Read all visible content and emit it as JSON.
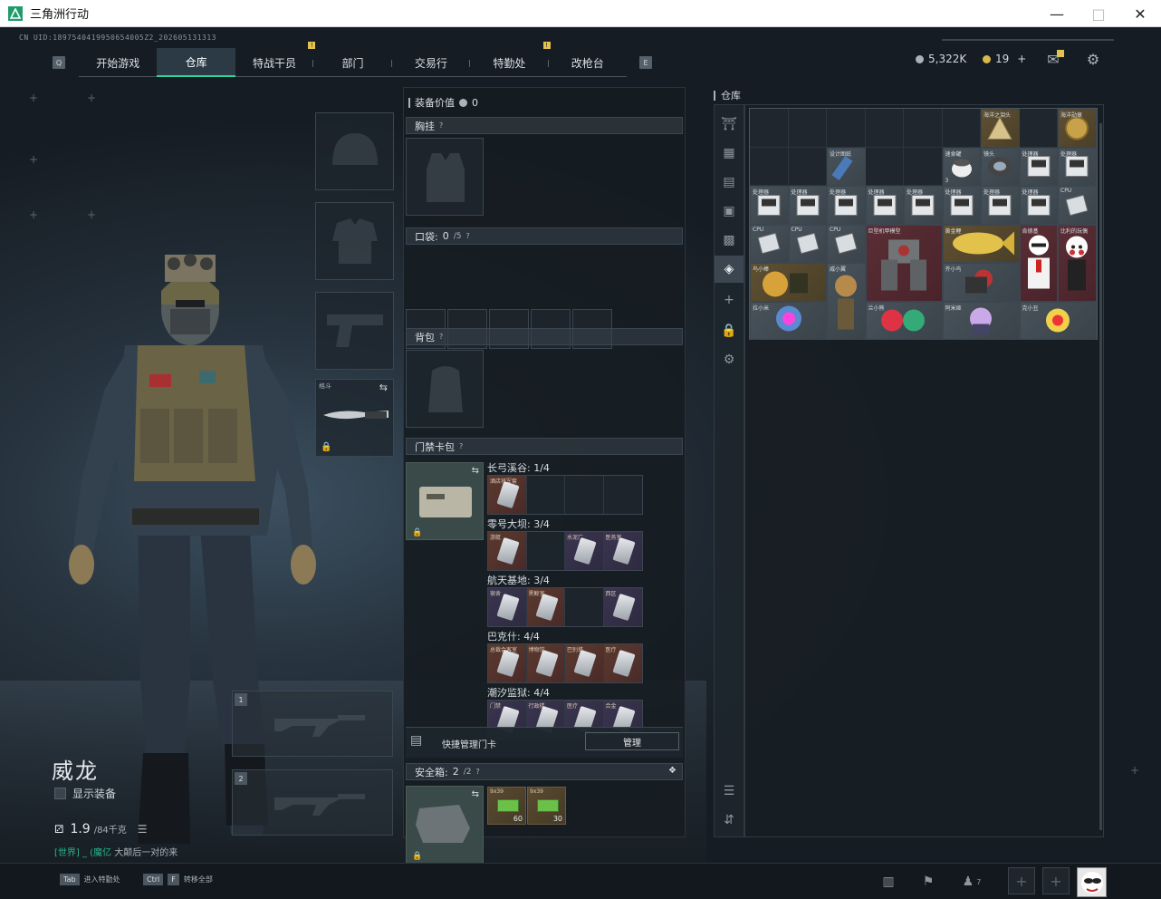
{
  "window": {
    "title": "三角洲行动"
  },
  "uid": "CN UID:1897540419950654005Z2_202605131313",
  "nav": {
    "left_key": "Q",
    "right_key": "E",
    "tabs": [
      {
        "label": "开始游戏",
        "active": false,
        "badge": false
      },
      {
        "label": "仓库",
        "active": true,
        "badge": false
      },
      {
        "label": "特战干员",
        "active": false,
        "badge": true
      },
      {
        "label": "部门",
        "active": false,
        "badge": false
      },
      {
        "label": "交易行",
        "active": false,
        "badge": false
      },
      {
        "label": "特勤处",
        "active": false,
        "badge": true
      },
      {
        "label": "改枪台",
        "active": false,
        "badge": false
      }
    ]
  },
  "currency": {
    "hafcoin": "5,322K",
    "coupons": "19",
    "add": "+"
  },
  "operator": {
    "name": "威龙",
    "show_equipment": "显示装备",
    "weight": "1.9",
    "weight_max": "/84千克",
    "chat_channel": "[世界] _ (魔亿",
    "chat_message": "大颠后一对的来"
  },
  "melee": {
    "label": "格斗"
  },
  "weapon_slots": [
    "1",
    "2"
  ],
  "equipment": {
    "value_label": "装备价值",
    "value": "0",
    "chest_rig": "胸挂",
    "pockets": "口袋:",
    "pockets_count": "0",
    "pockets_max": "/5",
    "backpack": "背包",
    "keycard_case": "门禁卡包",
    "maps": [
      {
        "name": "长弓溪谷: 1/4",
        "cards": [
          {
            "label": "酒店将军套",
            "q": "gold"
          },
          {
            "label": "",
            "q": ""
          },
          {
            "label": "",
            "q": ""
          },
          {
            "label": "",
            "q": ""
          }
        ]
      },
      {
        "name": "零号大坝: 3/4",
        "cards": [
          {
            "label": "游艇",
            "q": "gold"
          },
          {
            "label": "",
            "q": ""
          },
          {
            "label": "水泥厂",
            "q": "purple"
          },
          {
            "label": "医务室",
            "q": "purple"
          }
        ]
      },
      {
        "name": "航天基地: 3/4",
        "cards": [
          {
            "label": "宿舍",
            "q": "purple"
          },
          {
            "label": "黑鲸室",
            "q": "gold"
          },
          {
            "label": "",
            "q": ""
          },
          {
            "label": "西区",
            "q": "purple"
          }
        ]
      },
      {
        "name": "巴克什: 4/4",
        "cards": [
          {
            "label": "总裁会客室",
            "q": "gold"
          },
          {
            "label": "博物馆",
            "q": "gold"
          },
          {
            "label": "巴别塔",
            "q": "gold"
          },
          {
            "label": "医疗",
            "q": "gold"
          }
        ]
      },
      {
        "name": "潮汐监狱: 4/4",
        "cards": [
          {
            "label": "门禁",
            "q": "purple"
          },
          {
            "label": "行政楼",
            "q": "purple"
          },
          {
            "label": "医疗",
            "q": "purple"
          },
          {
            "label": "合金",
            "q": "purple"
          }
        ]
      }
    ],
    "quick_manage_label": "快捷管理门卡",
    "manage_button": "管理",
    "safebox": "安全箱:",
    "safebox_count": "2",
    "safebox_max": "/2",
    "ammo": [
      {
        "label": "9x39",
        "count": "60"
      },
      {
        "label": "9x39",
        "count": "30"
      }
    ]
  },
  "warehouse": {
    "title": "仓库",
    "items": [
      {
        "label": "海洋之泪头",
        "q": "gold",
        "icon": "gold-triangle"
      },
      {
        "label": "海洋勋章",
        "q": "gold",
        "icon": "gold-medal"
      },
      {
        "label": "设计图纸",
        "q": "gray",
        "icon": "blueprint"
      },
      {
        "label": "速食罐",
        "q": "gray",
        "icon": "can"
      },
      {
        "label": "镜头",
        "q": "gray",
        "icon": "lens"
      },
      {
        "label": "处理器",
        "q": "gray",
        "icon": "device"
      },
      {
        "label": "处理器",
        "q": "gray",
        "icon": "device"
      },
      {
        "label": "处理器",
        "q": "gray",
        "icon": "device"
      },
      {
        "label": "CPU",
        "q": "gray",
        "icon": "cpu"
      },
      {
        "label": "CPU",
        "q": "gray",
        "icon": "cpu"
      },
      {
        "label": "CPU",
        "q": "gray",
        "icon": "cpu"
      },
      {
        "label": "巨型机甲模型",
        "q": "red",
        "icon": "mech"
      },
      {
        "label": "黄金鲤",
        "q": "gold",
        "icon": "fish"
      },
      {
        "label": "肯德基",
        "q": "red",
        "icon": "figure"
      },
      {
        "label": "比利的玩偶",
        "q": "red",
        "icon": "puppet"
      },
      {
        "label": "鸟小棒",
        "q": "gold",
        "icon": "toy"
      },
      {
        "label": "威小翼",
        "q": "gray",
        "icon": "toy2"
      },
      {
        "label": "齐小鸟",
        "q": "gray",
        "icon": "toy3"
      },
      {
        "label": "拉小米",
        "q": "gray",
        "icon": "toy4"
      },
      {
        "label": "兰小熊",
        "q": "gray",
        "icon": "toy5"
      },
      {
        "label": "阿米娅",
        "q": "gray",
        "icon": "toy6"
      },
      {
        "label": "克小丑",
        "q": "gray",
        "icon": "toy7"
      }
    ],
    "sub_counts": {
      "can": "3"
    }
  },
  "bottom": {
    "hint1_key": "Tab",
    "hint1_text": "进入特勤处",
    "hint2_key1": "Ctrl",
    "hint2_key2": "F",
    "hint2_text": "转移全部",
    "friends_count": "7"
  },
  "colors": {
    "accent": "#29d59c",
    "badge": "#e3c24d",
    "gold_quality": "#5f5032",
    "red_quality": "#5a2e35",
    "purple_quality": "#413a58"
  }
}
